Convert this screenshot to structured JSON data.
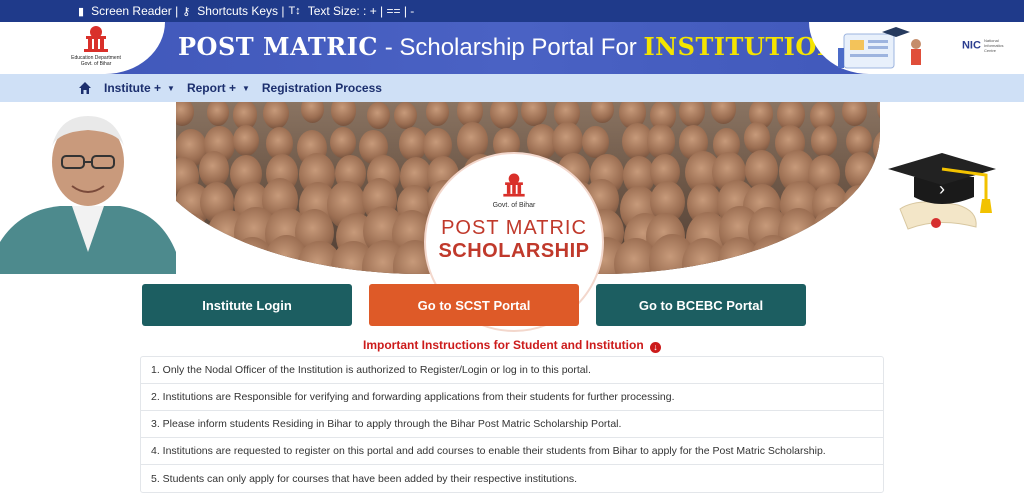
{
  "accessibility_bar": {
    "screen_reader": "Screen Reader |",
    "shortcuts": "Shortcuts Keys |",
    "text_size_label": "Text Size: : + | == | -"
  },
  "header": {
    "emblem_caption_line1": "Education Department",
    "emblem_caption_line2": "Govt. of Bihar",
    "title_bold": "POST MATRIC",
    "title_mid": "- Scholarship Portal For",
    "title_highlight": "INSTITUTION",
    "nic_label": "NIC",
    "nic_sub": "National Informatics Centre"
  },
  "nav": {
    "items": [
      {
        "label": "Institute +"
      },
      {
        "label": "Report +"
      },
      {
        "label": "Registration Process"
      }
    ]
  },
  "banner": {
    "badge_govt": "Govt. of Bihar",
    "badge_line1": "POST MATRIC",
    "badge_line2": "SCHOLARSHIP",
    "next_arrow": "›"
  },
  "buttons": {
    "institute_login": "Institute Login",
    "scst_portal": "Go to SCST Portal",
    "bcebc_portal": "Go to BCEBC Portal"
  },
  "instructions": {
    "title": "Important Instructions for Student and Institution",
    "items": [
      "1. Only the Nodal Officer of the Institution is authorized to Register/Login or log in to this portal.",
      "2. Institutions are Responsible for verifying and forwarding applications from their students for further processing.",
      "3. Please inform students Residing in Bihar to apply through the Bihar Post Matric Scholarship Portal.",
      "4. Institutions are requested to register on this portal and add courses to enable their students from Bihar to apply for the Post Matric Scholarship.",
      "5. Students can only apply for courses that have been added by their respective institutions."
    ]
  },
  "colors": {
    "header_blue": "#3f56b8",
    "accessibility_bar": "#1f3a8a",
    "nav_bg": "#cfe0f6",
    "highlight_yellow": "#f4e400",
    "teal_button": "#1c5e61",
    "orange_button": "#de5a28",
    "instruction_red": "#cc1b1b"
  }
}
